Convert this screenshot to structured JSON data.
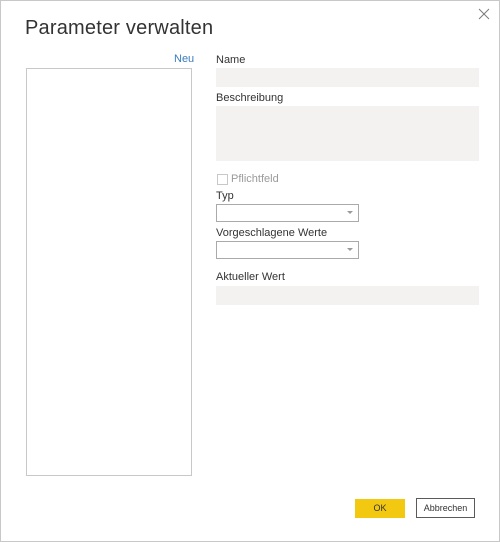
{
  "dialog": {
    "title": "Parameter verwalten",
    "close_icon": "close-icon"
  },
  "list": {
    "new_label": "Neu"
  },
  "form": {
    "name_label": "Name",
    "name_value": "",
    "description_label": "Beschreibung",
    "description_value": "",
    "required_label": "Pflichtfeld",
    "type_label": "Typ",
    "type_value": "",
    "suggested_label": "Vorgeschlagene Werte",
    "suggested_value": "",
    "current_label": "Aktueller Wert",
    "current_value": ""
  },
  "buttons": {
    "ok_label": "OK",
    "cancel_label": "Abbrechen"
  },
  "colors": {
    "accent": "#f2c811",
    "link": "#3a7bbf",
    "field_bg": "#f3f2f1"
  }
}
